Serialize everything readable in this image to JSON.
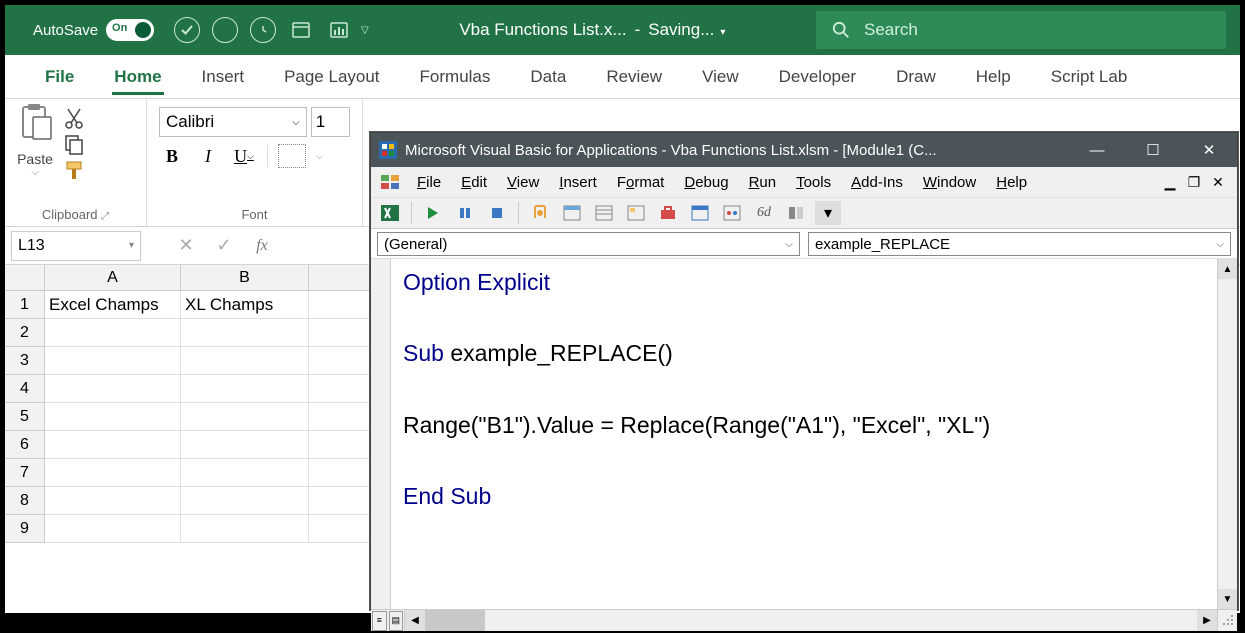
{
  "titlebar": {
    "autosave_label": "AutoSave",
    "toggle_text": "On",
    "filename": "Vba Functions List.x...",
    "status": "Saving...",
    "search_placeholder": "Search"
  },
  "ribbon_tabs": [
    "File",
    "Home",
    "Insert",
    "Page Layout",
    "Formulas",
    "Data",
    "Review",
    "View",
    "Developer",
    "Draw",
    "Help",
    "Script Lab"
  ],
  "ribbon": {
    "paste_label": "Paste",
    "clipboard_label": "Clipboard",
    "font_name": "Calibri",
    "font_size": "1",
    "font_label": "Font"
  },
  "namebox": "L13",
  "columns": [
    "A",
    "B"
  ],
  "rows": [
    "1",
    "2",
    "3",
    "4",
    "5",
    "6",
    "7",
    "8",
    "9"
  ],
  "cells": {
    "A1": "Excel Champs",
    "B1": "XL Champs"
  },
  "vba": {
    "title": "Microsoft Visual Basic for Applications - Vba Functions List.xlsm - [Module1 (C...",
    "menu": [
      "File",
      "Edit",
      "View",
      "Insert",
      "Format",
      "Debug",
      "Run",
      "Tools",
      "Add-Ins",
      "Window",
      "Help"
    ],
    "combo_left": "(General)",
    "combo_right": "example_REPLACE",
    "code": {
      "l1_kw": "Option Explicit",
      "l2_kw": "Sub",
      "l2_txt": " example_REPLACE()",
      "l3": "Range(\"B1\").Value = Replace(Range(\"A1\"), \"Excel\", \"XL\")",
      "l4_kw": "End Sub"
    }
  }
}
